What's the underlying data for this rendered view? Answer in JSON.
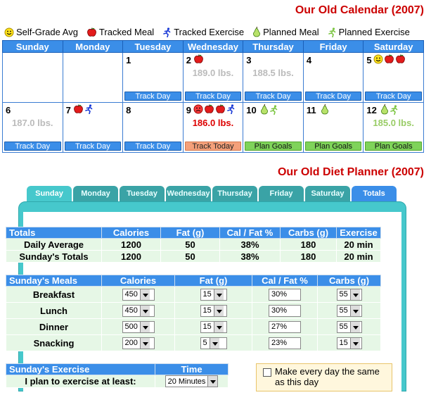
{
  "calendar": {
    "title": "Our Old Calendar (2007)",
    "legend": [
      {
        "icon": "smiley-icon",
        "label": "Self-Grade Avg"
      },
      {
        "icon": "apple-icon",
        "label": "Tracked Meal"
      },
      {
        "icon": "runner-icon",
        "label": "Tracked Exercise"
      },
      {
        "icon": "pear-icon",
        "label": "Planned Meal"
      },
      {
        "icon": "runner-green-icon",
        "label": "Planned Exercise"
      }
    ],
    "days": [
      "Sunday",
      "Monday",
      "Tuesday",
      "Wednesday",
      "Thursday",
      "Friday",
      "Saturday"
    ],
    "weeks": [
      [
        {
          "num": "",
          "weight": "",
          "icons": [],
          "button": ""
        },
        {
          "num": "",
          "weight": "",
          "icons": [],
          "button": ""
        },
        {
          "num": "1",
          "weight": "",
          "icons": [],
          "button": "Track Day"
        },
        {
          "num": "2",
          "weight": "189.0 lbs.",
          "icons": [
            "apple-icon"
          ],
          "button": "Track Day"
        },
        {
          "num": "3",
          "weight": "188.5 lbs.",
          "icons": [],
          "button": "Track Day"
        },
        {
          "num": "4",
          "weight": "",
          "icons": [],
          "button": "Track Day"
        },
        {
          "num": "5",
          "weight": "",
          "icons": [
            "smiley-icon",
            "apple-icon",
            "apple-icon"
          ],
          "button": "Track Day"
        }
      ],
      [
        {
          "num": "6",
          "weight": "187.0 lbs.",
          "icons": [],
          "button": "Track Day"
        },
        {
          "num": "7",
          "weight": "",
          "icons": [
            "apple-icon",
            "runner-icon"
          ],
          "button": "Track Day"
        },
        {
          "num": "8",
          "weight": "",
          "icons": [],
          "button": "Track Day"
        },
        {
          "num": "9",
          "weight": "186.0 lbs.",
          "weightStyle": "red",
          "icons": [
            "frown-icon",
            "apple-icon",
            "apple-icon",
            "runner-icon"
          ],
          "button": "Track Today",
          "btnStyle": "today"
        },
        {
          "num": "10",
          "weight": "",
          "icons": [
            "pear-icon",
            "runner-green-icon"
          ],
          "button": "Plan Goals",
          "btnStyle": "goals"
        },
        {
          "num": "11",
          "weight": "",
          "icons": [
            "pear-icon"
          ],
          "button": "Plan Goals",
          "btnStyle": "goals"
        },
        {
          "num": "12",
          "weight": "185.0 lbs.",
          "weightStyle": "green",
          "icons": [
            "pear-icon",
            "runner-green-icon"
          ],
          "button": "Plan Goals",
          "btnStyle": "goals"
        }
      ]
    ],
    "colors": {
      "header": "#3b8ee8",
      "today": "#f4a07a",
      "goals": "#7fd35a",
      "title": "#cc0000"
    }
  },
  "planner": {
    "title": "Our Old Diet Planner (2007)",
    "tabs": [
      "Sunday",
      "Monday",
      "Tuesday",
      "Wednesday",
      "Thursday",
      "Friday",
      "Saturday",
      "Totals"
    ],
    "active_tab": "Sunday",
    "totals": {
      "headers": [
        "Totals",
        "Calories",
        "Fat (g)",
        "Cal / Fat %",
        "Carbs (g)",
        "Exercise"
      ],
      "rows": [
        [
          "Daily Average",
          "1200",
          "50",
          "38%",
          "180",
          "20 min"
        ],
        [
          "Sunday's Totals",
          "1200",
          "50",
          "38%",
          "180",
          "20 min"
        ]
      ]
    },
    "meals": {
      "headers": [
        "Sunday's Meals",
        "Calories",
        "Fat (g)",
        "Cal / Fat %",
        "Carbs (g)"
      ],
      "rows": [
        {
          "name": "Breakfast",
          "calories": "450",
          "fat": "15",
          "pct": "30%",
          "carbs": "55"
        },
        {
          "name": "Lunch",
          "calories": "450",
          "fat": "15",
          "pct": "30%",
          "carbs": "55"
        },
        {
          "name": "Dinner",
          "calories": "500",
          "fat": "15",
          "pct": "27%",
          "carbs": "55"
        },
        {
          "name": "Snacking",
          "calories": "200",
          "fat": "5",
          "pct": "23%",
          "carbs": "15"
        }
      ]
    },
    "exercise": {
      "headers": [
        "Sunday's Exercise",
        "Time"
      ],
      "row_label": "I plan to exercise at least:",
      "time": "20 Minutes"
    },
    "note": "Make every day the same as this day"
  }
}
